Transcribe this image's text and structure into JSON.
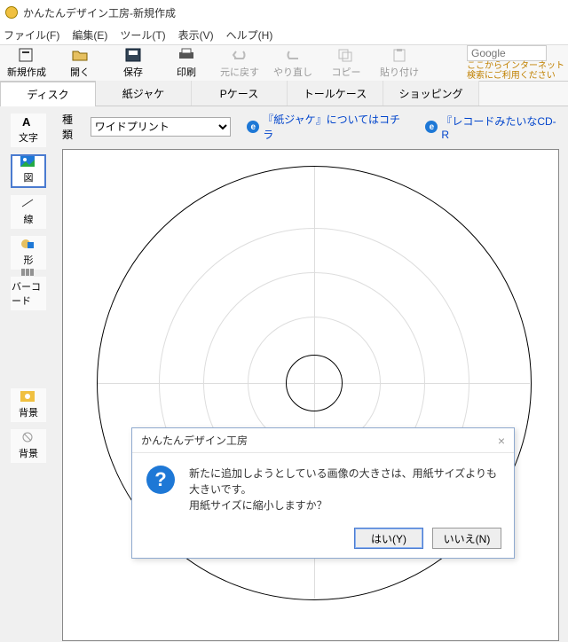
{
  "window": {
    "title": "かんたんデザイン工房-新規作成"
  },
  "menu": {
    "file": "ファイル(F)",
    "edit": "編集(E)",
    "tool": "ツール(T)",
    "view": "表示(V)",
    "help": "ヘルプ(H)"
  },
  "toolbar": {
    "new": "新規作成",
    "open": "開く",
    "save": "保存",
    "print": "印刷",
    "undo": "元に戻す",
    "redo": "やり直し",
    "copy": "コピー",
    "paste": "貼り付け"
  },
  "search": {
    "placeholder": "Google",
    "note1": "ここからインターネット",
    "note2": "検索にご利用ください"
  },
  "tabs": {
    "disc": "ディスク",
    "paper": "紙ジャケ",
    "pcase": "Pケース",
    "tall": "トールケース",
    "shopping": "ショッピング"
  },
  "side": {
    "text": "文字",
    "image": "図",
    "line": "線",
    "shape": "形",
    "barcode": "バーコード",
    "bg1": "背景",
    "bg2": "背景"
  },
  "typerow": {
    "label": "種類",
    "value": "ワイドプリント"
  },
  "links": {
    "paper": "『紙ジャケ』についてはコチラ",
    "record": "『レコードみたいなCD-R"
  },
  "dialog": {
    "title": "かんたんデザイン工房",
    "line1": "新たに追加しようとしている画像の大きさは、用紙サイズよりも大きいです。",
    "line2": "用紙サイズに縮小しますか？",
    "yes": "はい(Y)",
    "no": "いいえ(N)",
    "close": "×"
  }
}
